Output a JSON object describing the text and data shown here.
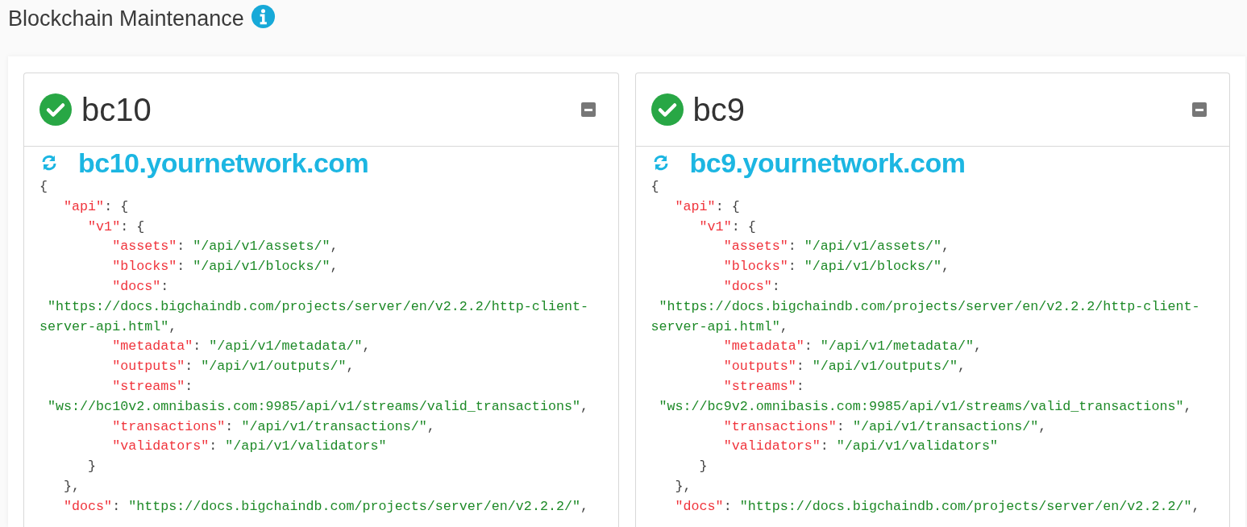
{
  "page_title": "Blockchain Maintenance",
  "nodes": [
    {
      "name": "bc10",
      "healthy": true,
      "host": "bc10.yournetwork.com",
      "code": "{\n   \"api\": {\n      \"v1\": {\n         \"assets\": \"/api/v1/assets/\",\n         \"blocks\": \"/api/v1/blocks/\",\n         \"docs\":\n \"https://docs.bigchaindb.com/projects/server/en/v2.2.2/http-client-\nserver-api.html\",\n         \"metadata\": \"/api/v1/metadata/\",\n         \"outputs\": \"/api/v1/outputs/\",\n         \"streams\":\n \"ws://bc10v2.omnibasis.com:9985/api/v1/streams/valid_transactions\",\n         \"transactions\": \"/api/v1/transactions/\",\n         \"validators\": \"/api/v1/validators\"\n      }\n   },\n   \"docs\": \"https://docs.bigchaindb.com/projects/server/en/v2.2.2/\","
    },
    {
      "name": "bc9",
      "healthy": true,
      "host": "bc9.yournetwork.com",
      "code": "{\n   \"api\": {\n      \"v1\": {\n         \"assets\": \"/api/v1/assets/\",\n         \"blocks\": \"/api/v1/blocks/\",\n         \"docs\":\n \"https://docs.bigchaindb.com/projects/server/en/v2.2.2/http-client-\nserver-api.html\",\n         \"metadata\": \"/api/v1/metadata/\",\n         \"outputs\": \"/api/v1/outputs/\",\n         \"streams\":\n \"ws://bc9v2.omnibasis.com:9985/api/v1/streams/valid_transactions\",\n         \"transactions\": \"/api/v1/transactions/\",\n         \"validators\": \"/api/v1/validators\"\n      }\n   },\n   \"docs\": \"https://docs.bigchaindb.com/projects/server/en/v2.2.2/\","
    }
  ]
}
